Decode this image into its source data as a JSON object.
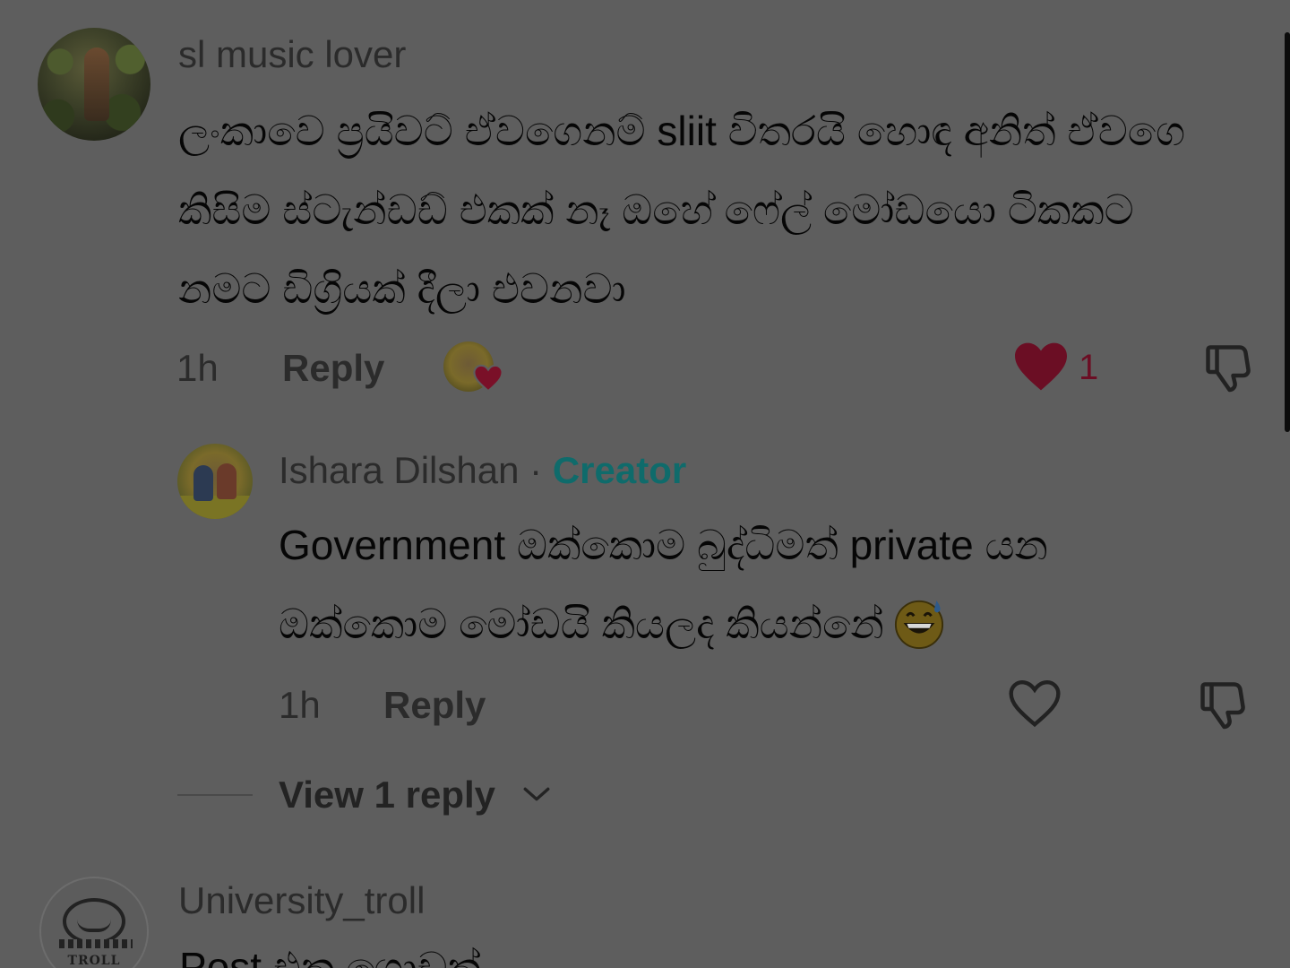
{
  "comments": [
    {
      "username": "sl music lover",
      "text_lines": [
        "ලංකාවෙ ප්‍රයිවට් ඒවගෙනම් sliit විතරයි හොඳ අනිත් ඒවගෙ",
        "කිසිම ස්ටැන්ඩඩ් එකක් නෑ ඔහේ ෆේල් මෝඩයො ටිකකට",
        "නමට ඩිග්‍රියක් දීලා එවනවා"
      ],
      "time": "1h",
      "reply_label": "Reply",
      "like_count": "1",
      "liked_by_creator": true,
      "liked": true
    },
    {
      "username": "Ishara Dilshan",
      "separator": "·",
      "badge": "Creator",
      "text_lines": [
        "Government ඔක්කොම බුද්ධිමත් private යන",
        "ඔක්කොම මෝඩයි කියලද කියන්නේ"
      ],
      "emoji": "grinning-face-with-sweat",
      "time": "1h",
      "reply_label": "Reply",
      "liked": false
    }
  ],
  "view_replies": "View 1 reply",
  "next_comment": {
    "username": "University_troll",
    "avatar_text": "TROLL",
    "text_partial": "Post එක ගොඩක්"
  },
  "colors": {
    "like_red": "#6b0e24",
    "creator_badge": "#0f6b6b",
    "overlay_bg": "#5e5e5e"
  },
  "icons": [
    "heart-icon",
    "heart-outline-icon",
    "dislike-icon",
    "chevron-down-icon"
  ]
}
